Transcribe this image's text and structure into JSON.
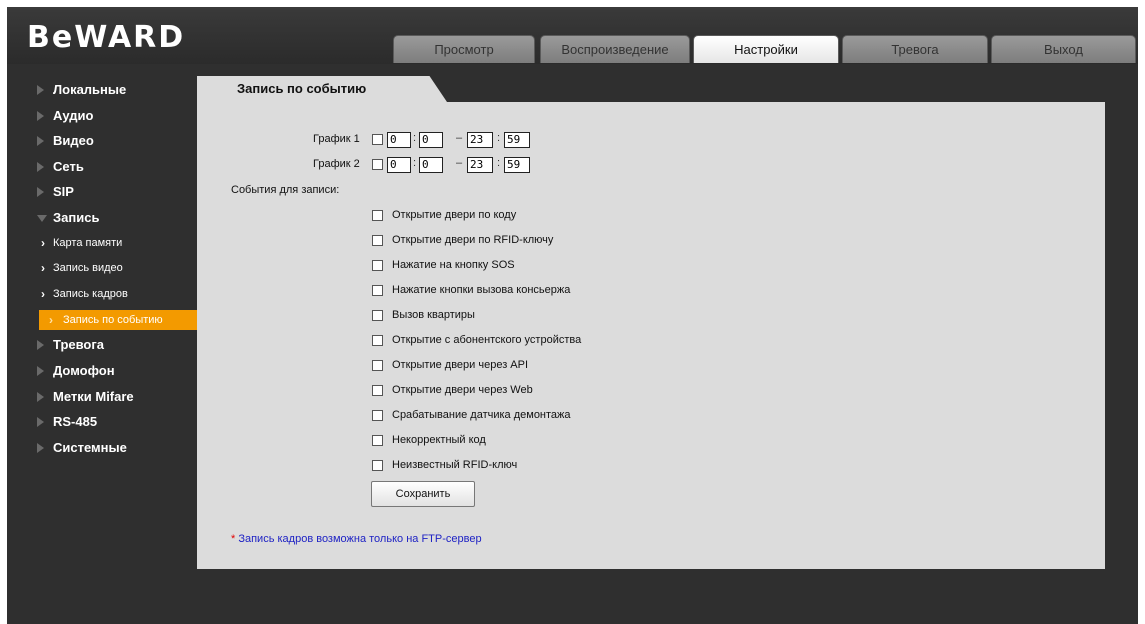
{
  "brand": {
    "logo": "BeWARD"
  },
  "tabs": [
    {
      "label": "Просмотр"
    },
    {
      "label": "Воспроизведение"
    },
    {
      "label": "Настройки"
    },
    {
      "label": "Тревога"
    },
    {
      "label": "Выход"
    }
  ],
  "sidebar": {
    "items": [
      {
        "label": "Локальные"
      },
      {
        "label": "Аудио"
      },
      {
        "label": "Видео"
      },
      {
        "label": "Сеть"
      },
      {
        "label": "SIP"
      },
      {
        "label": "Запись"
      },
      {
        "label": "Тревога"
      },
      {
        "label": "Домофон"
      },
      {
        "label": "Метки Mifare"
      },
      {
        "label": "RS-485"
      },
      {
        "label": "Системные"
      }
    ],
    "subitems": [
      {
        "label": "Карта памяти"
      },
      {
        "label": "Запись видео"
      },
      {
        "label": "Запись кадров"
      },
      {
        "label": "Запись по событию"
      }
    ],
    "active_subitem": "Запись по событию"
  },
  "panel": {
    "title": "Запись по событию",
    "schedule1": {
      "label": "График 1",
      "from_h": "0",
      "from_m": "0",
      "to_h": "23",
      "to_m": "59"
    },
    "schedule2": {
      "label": "График 2",
      "from_h": "0",
      "from_m": "0",
      "to_h": "23",
      "to_m": "59"
    },
    "events_label": "События для записи:",
    "events": [
      {
        "label": "Открытие двери по коду"
      },
      {
        "label": "Открытие двери по RFID-ключу"
      },
      {
        "label": "Нажатие на кнопку SOS"
      },
      {
        "label": "Нажатие кнопки вызова консьержа"
      },
      {
        "label": "Вызов квартиры"
      },
      {
        "label": "Открытие с абонентского устройства"
      },
      {
        "label": "Открытие двери через API"
      },
      {
        "label": "Открытие двери через Web"
      },
      {
        "label": "Срабатывание датчика демонтажа"
      },
      {
        "label": "Некорректный код"
      },
      {
        "label": "Неизвестный RFID-ключ"
      }
    ],
    "save_label": "Сохранить",
    "note_star": "*",
    "note_text": "Запись кадров возможна только на FTP-сервер"
  },
  "colors": {
    "accent": "#f39a00",
    "background": "#2f2f2f",
    "panel": "#dcdcdc",
    "note": "#1f23c4"
  }
}
